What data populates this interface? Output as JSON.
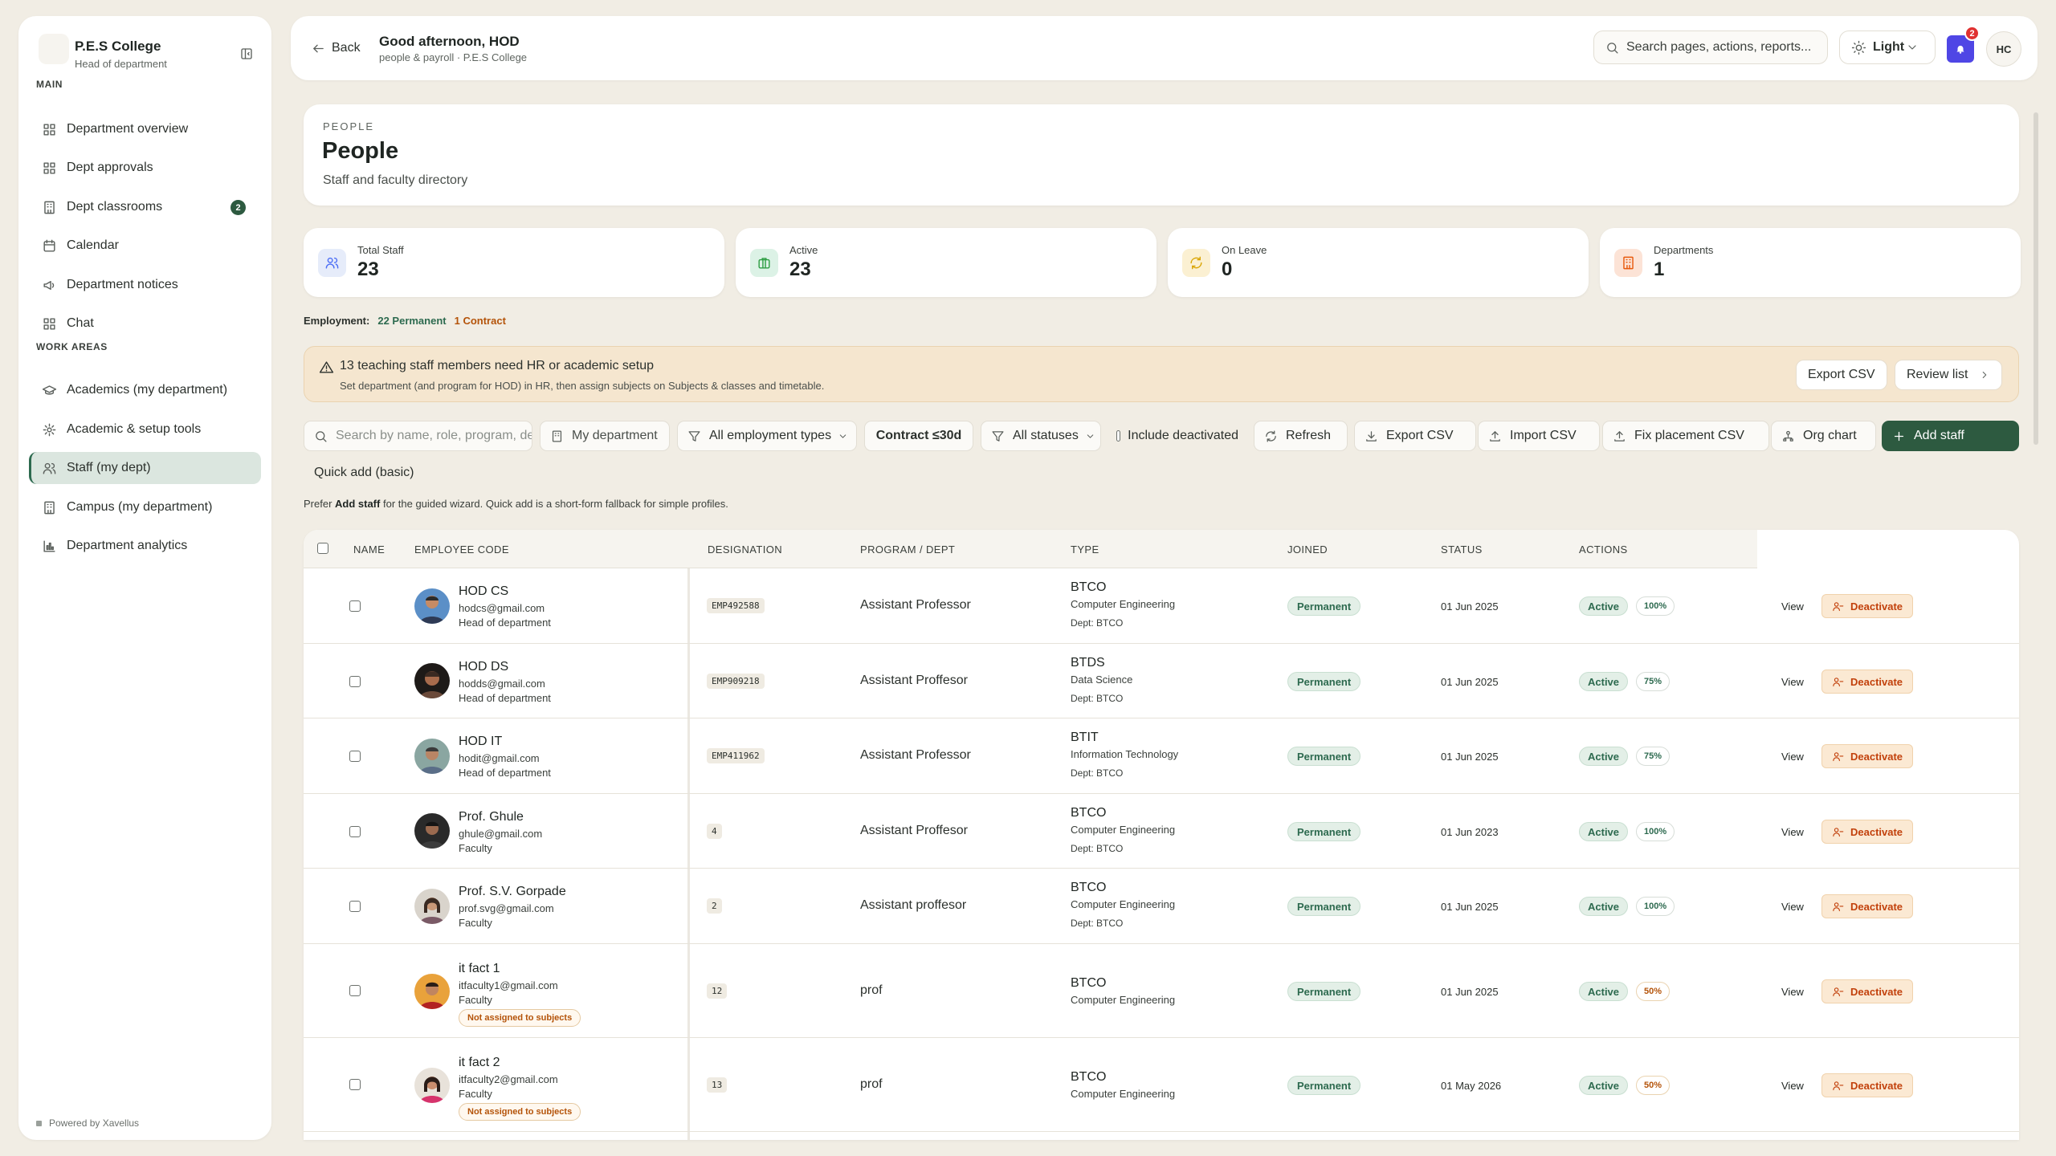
{
  "sidebar": {
    "college": "P.E.S College",
    "role": "Head of department",
    "main_label": "MAIN",
    "work_label": "WORK AREAS",
    "main_items": [
      {
        "label": "Department overview",
        "icon": "grid-icon"
      },
      {
        "label": "Dept approvals",
        "icon": "grid-icon"
      },
      {
        "label": "Dept classrooms",
        "icon": "building-icon",
        "badge": "2"
      },
      {
        "label": "Calendar",
        "icon": "calendar-icon"
      },
      {
        "label": "Department notices",
        "icon": "megaphone-icon"
      },
      {
        "label": "Chat",
        "icon": "grid-icon"
      }
    ],
    "work_items": [
      {
        "label": "Academics (my department)",
        "icon": "graduation-cap-icon"
      },
      {
        "label": "Academic & setup tools",
        "icon": "gear-icon"
      },
      {
        "label": "Staff (my dept)",
        "icon": "users-icon",
        "active": true
      },
      {
        "label": "Campus (my department)",
        "icon": "building-icon"
      },
      {
        "label": "Department analytics",
        "icon": "bar-chart-icon"
      }
    ],
    "powered": "Powered by Xavellus"
  },
  "header": {
    "back_label": "Back",
    "greeting": "Good afternoon, HOD",
    "breadcrumb": "people & payroll · P.E.S College",
    "search_placeholder": "Search pages, actions, reports...",
    "theme_label": "Light",
    "notif_count": "2",
    "avatar_initials": "HC"
  },
  "hero": {
    "eyebrow": "PEOPLE",
    "title": "People",
    "subtitle": "Staff and faculty directory"
  },
  "stats": [
    {
      "label": "Total Staff",
      "value": "23",
      "icon": "users-icon",
      "color": "#e6ecfa"
    },
    {
      "label": "Active",
      "value": "23",
      "icon": "briefcase-icon",
      "color": "#dcf2e6"
    },
    {
      "label": "On Leave",
      "value": "0",
      "icon": "refresh-icon",
      "color": "#fbf0d2"
    },
    {
      "label": "Departments",
      "value": "1",
      "icon": "building-icon",
      "color": "#fce3d6"
    }
  ],
  "employment": {
    "label": "Employment:",
    "permanent": "22 Permanent",
    "contract": "1 Contract"
  },
  "alert": {
    "title": "13 teaching staff members need HR or academic setup",
    "subtitle": "Set department (and program for HOD) in HR, then assign subjects on Subjects & classes and timetable.",
    "export_label": "Export CSV",
    "review_label": "Review list"
  },
  "toolbar": {
    "search_placeholder": "Search by name, role, program, department",
    "department_filter": "My department",
    "employment_filter": "All employment types",
    "contract_filter": "Contract ≤30d",
    "status_filter": "All statuses",
    "include_deactivated": "Include deactivated",
    "refresh": "Refresh",
    "export": "Export CSV",
    "import": "Import CSV",
    "fix_placement": "Fix placement CSV",
    "org_chart": "Org chart",
    "add_staff": "Add staff",
    "quick_add": "Quick add (basic)",
    "prefer_pre": "Prefer ",
    "prefer_bold": "Add staff",
    "prefer_post": " for the guided wizard. Quick add is a short-form fallback for simple profiles."
  },
  "table": {
    "columns": [
      "NAME",
      "EMPLOYEE CODE",
      "DESIGNATION",
      "PROGRAM / DEPT",
      "TYPE",
      "JOINED",
      "STATUS",
      "ACTIONS"
    ],
    "view_label": "View",
    "deactivate_label": "Deactivate",
    "rows": [
      {
        "name": "HOD CS",
        "email": "hodcs@gmail.com",
        "role": "Head of department",
        "code": "EMP492588",
        "designation": "Assistant Professor",
        "program": "BTCO",
        "dept": "Computer Engineering",
        "dept2": "Dept: BTCO",
        "type": "Permanent",
        "joined": "01 Jun 2025",
        "status": "Active",
        "pct": "100%"
      },
      {
        "name": "HOD DS",
        "email": "hodds@gmail.com",
        "role": "Head of department",
        "code": "EMP909218",
        "designation": "Assistant Proffesor",
        "program": "BTDS",
        "dept": "Data Science",
        "dept2": "Dept: BTCO",
        "type": "Permanent",
        "joined": "01 Jun 2025",
        "status": "Active",
        "pct": "75%"
      },
      {
        "name": "HOD IT",
        "email": "hodit@gmail.com",
        "role": "Head of department",
        "code": "EMP411962",
        "designation": "Assistant Professor",
        "program": "BTIT",
        "dept": "Information Technology",
        "dept2": "Dept: BTCO",
        "type": "Permanent",
        "joined": "01 Jun 2025",
        "status": "Active",
        "pct": "75%"
      },
      {
        "name": "Prof. Ghule",
        "email": "ghule@gmail.com",
        "role": "Faculty",
        "code": "4",
        "designation": "Assistant Proffesor",
        "program": "BTCO",
        "dept": "Computer Engineering",
        "dept2": "Dept: BTCO",
        "type": "Permanent",
        "joined": "01 Jun 2023",
        "status": "Active",
        "pct": "100%"
      },
      {
        "name": "Prof. S.V. Gorpade",
        "email": "prof.svg@gmail.com",
        "role": "Faculty",
        "code": "2",
        "designation": "Assistant proffesor",
        "program": "BTCO",
        "dept": "Computer Engineering",
        "dept2": "Dept: BTCO",
        "type": "Permanent",
        "joined": "01 Jun 2025",
        "status": "Active",
        "pct": "100%"
      },
      {
        "name": "it fact 1",
        "email": "itfaculty1@gmail.com",
        "role": "Faculty",
        "tag": "Not assigned to subjects",
        "code": "12",
        "designation": "prof",
        "program": "BTCO",
        "dept": "Computer Engineering",
        "type": "Permanent",
        "joined": "01 Jun 2025",
        "status": "Active",
        "pct": "50%"
      },
      {
        "name": "it fact 2",
        "email": "itfaculty2@gmail.com",
        "role": "Faculty",
        "tag": "Not assigned to subjects",
        "code": "13",
        "designation": "prof",
        "program": "BTCO",
        "dept": "Computer Engineering",
        "type": "Permanent",
        "joined": "01 May 2026",
        "status": "Active",
        "pct": "50%"
      }
    ]
  }
}
